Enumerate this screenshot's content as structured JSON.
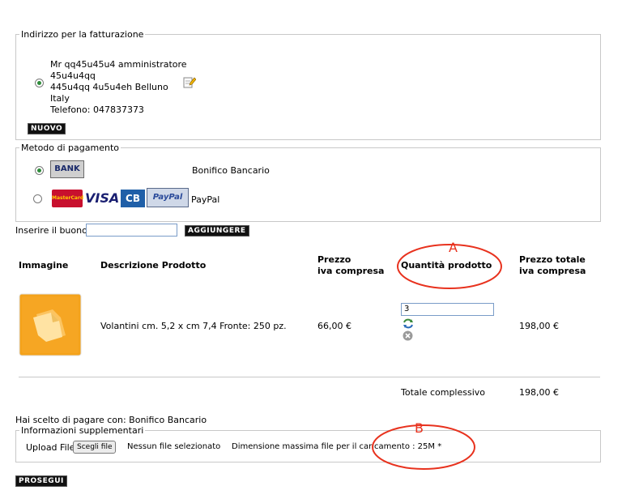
{
  "billing": {
    "legend": "Indirizzo per la fatturazione",
    "address_lines": [
      "Mr qq45u45u4 amministratore",
      "45u4u4qq",
      "445u4qq 4u5u4eh Belluno",
      "Italy",
      "Telefono: 047837373"
    ],
    "new_button": "NUOVO"
  },
  "payment": {
    "legend": "Metodo di pagamento",
    "bank_logo": "BANK",
    "bank_label": "Bonifico Bancario",
    "card_logos": [
      "MasterCard",
      "VISA",
      "CB",
      "PayPal"
    ],
    "paypal_label": "PayPal"
  },
  "voucher": {
    "label": "Inserire il buono",
    "button": "AGGIUNGERE"
  },
  "table": {
    "headers": {
      "image": "Immagine",
      "description": "Descrizione Prodotto",
      "price_line1": "Prezzo",
      "price_line2": "iva compresa",
      "quantity": "Quantità prodotto",
      "total_line1": "Prezzo totale",
      "total_line2": "iva compresa"
    },
    "rows": [
      {
        "description": "Volantini cm. 5,2 x cm 7,4 Fronte: 250 pz.",
        "price": "66,00 €",
        "quantity": "3",
        "total": "198,00 €"
      }
    ],
    "grand_total_label": "Totale complessivo",
    "grand_total_value": "198,00 €"
  },
  "payment_choice": "Hai scelto di pagare con: Bonifico Bancario",
  "extra": {
    "legend": "Informazioni supplementari",
    "upload_label": "Upload File",
    "choose_button": "Scegli file",
    "no_file": "Nessun file selezionato",
    "max_size": "Dimensione massima file per il caricamento : 25M *"
  },
  "proceed_button": "PROSEGUI",
  "annotations": {
    "a": "A",
    "b": "B",
    "color": "#e8321e"
  },
  "icons": [
    "edit-icon",
    "product-file-icon",
    "refresh-icon",
    "delete-icon"
  ]
}
